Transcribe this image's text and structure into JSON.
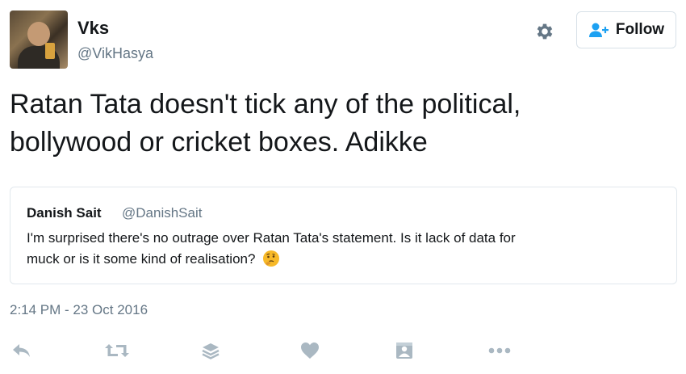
{
  "user": {
    "name": "Vks",
    "handle": "@VikHasya"
  },
  "header": {
    "settings_icon": "gear-icon",
    "follow_label": "Follow",
    "follow_icon": "add-user-icon"
  },
  "tweet": {
    "text_line1": "Ratan Tata doesn't tick any of the political,",
    "text_line2": "bollywood or cricket boxes. Adikke",
    "timestamp": "2:14 PM - 23 Oct 2016"
  },
  "quoted_tweet": {
    "name": "Danish Sait",
    "handle": "@DanishSait",
    "text_line1": "I'm surprised there's no outrage over Ratan Tata's statement. Is it lack of data for",
    "text_line2": "muck or is it some kind of realisation?",
    "emoji": "thinking-face"
  },
  "actions": [
    {
      "icon": "reply-icon"
    },
    {
      "icon": "retweet-icon"
    },
    {
      "icon": "layers-icon"
    },
    {
      "icon": "heart-icon"
    },
    {
      "icon": "moments-icon"
    },
    {
      "icon": "more-icon"
    }
  ],
  "colors": {
    "text": "#14171a",
    "secondary": "#657786",
    "accent": "#1da1f2",
    "action_icon": "#aab8c2",
    "border": "#e1e8ed"
  }
}
